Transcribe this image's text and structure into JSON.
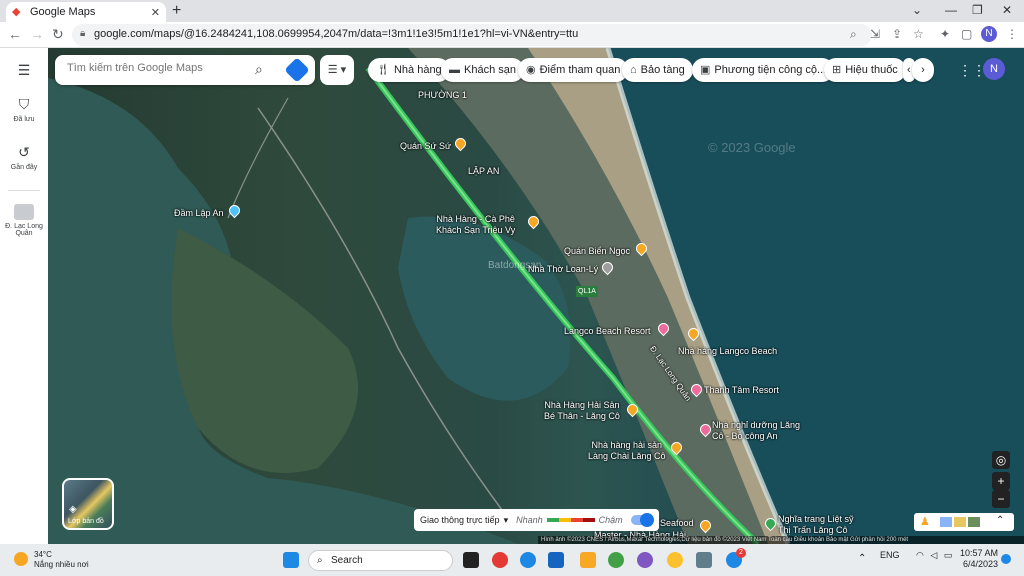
{
  "browser": {
    "tab_title": "Google Maps",
    "url": "google.com/maps/@16.2484241,108.0699954,2047m/data=!3m1!1e3!5m1!1e1?hl=vi-VN&entry=ttu",
    "profile_initial": "N"
  },
  "sidebar": {
    "items": [
      {
        "label": "Đã lưu",
        "icon": "bookmark-icon"
      },
      {
        "label": "Gần đây",
        "icon": "history-icon"
      },
      {
        "label": "Đ. Lạc Long Quân",
        "icon": "street-thumbnail-icon"
      }
    ]
  },
  "search": {
    "placeholder": "Tìm kiếm trên Google Maps"
  },
  "chips": [
    "Nhà hàng",
    "Khách sạn",
    "Điểm tham quan",
    "Bảo tàng",
    "Phương tiện công cộ...",
    "Hiệu thuốc"
  ],
  "map_labels": {
    "phuong1": "PHƯỜNG 1",
    "lapan": "LẬP AN",
    "quan_su_su": "Quán Sứ Sứ",
    "dam_lap_an": "Đầm Lập An",
    "nha_hang_ca_phe": "Nhà Hàng - Cà Phê",
    "khach_san_trieu_vy": "Khách Sạn Triệu Vy",
    "quan_bien_ngoc": "Quán Biển Ngọc",
    "nha_tho": "Nhà Thờ Loan-Lý",
    "batdongsan": "Batdongsan",
    "road_ql1a": "QL1A",
    "langco_resort": "Langco Beach Resort",
    "nha_hang_langco": "Nhà hàng Langco Beach",
    "duong_lac_long_quan": "Đ. Lạc Long Quân",
    "thanh_tam": "Thanh Tâm Resort",
    "hai_san_be_than_1": "Nhà Hàng Hải Sản",
    "hai_san_be_than_2": "Bé Thân - Lăng Cô",
    "nha_nghi_1": "Nhà nghỉ dưỡng Lăng",
    "nha_nghi_2": "Cô - Bộ công An",
    "hai_san_lang_chai_1": "Nhà hàng hải sản",
    "hai_san_lang_chai_2": "Làng Chài Lăng Cô",
    "seafood": "Seafood",
    "master": "Master - Nhà Hàng Hải",
    "nghia_trang_1": "Nghĩa trang Liệt sỹ",
    "nghia_trang_2": "Thị Trấn Lăng Cô",
    "watermark": "© 2023 Google"
  },
  "layers": {
    "label": "Lớp bản đồ"
  },
  "traffic": {
    "label": "Giao thông trực tiếp",
    "fast": "Nhanh",
    "slow": "Chậm"
  },
  "credits": "Hình ảnh ©2023 CNES / Airbus,Maxar Technologies,Dữ liệu bản đồ ©2023   Việt Nam   Toàn cầu   Điều khoản   Bảo mật   Gửi phản hồi   200 mét",
  "taskbar": {
    "temperature": "34°C",
    "weather": "Nắng nhiều nơi",
    "search": "Search",
    "lang": "ENG",
    "time": "10:57 AM",
    "date": "6/4/2023",
    "badge": "2"
  }
}
